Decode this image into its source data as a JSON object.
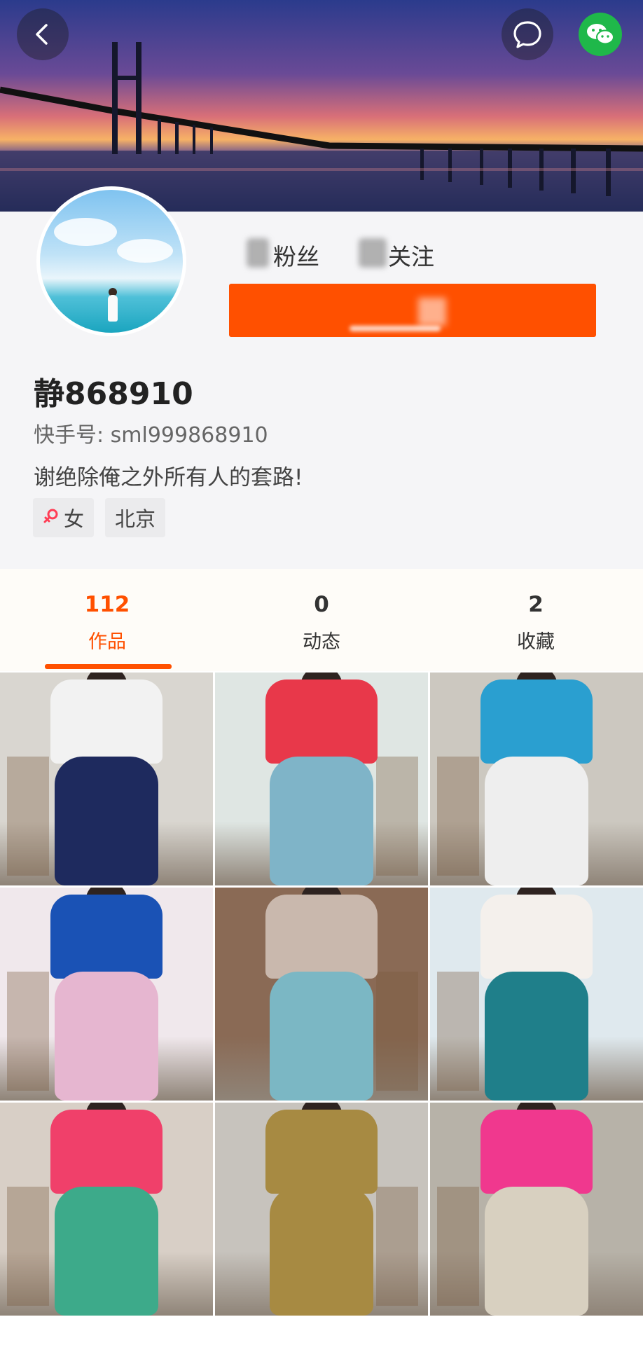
{
  "header": {
    "back_icon": "chevron-left-icon",
    "message_icon": "chat-bubble-icon",
    "share_icon": "wechat-icon",
    "wechat_color": "#1fb84a"
  },
  "profile": {
    "fans_label": "粉丝",
    "following_label": "关注",
    "follow_button_color": "#ff5000",
    "name": "静868910",
    "kuaishou_id": "快手号: sml999868910",
    "bio": "谢绝除俺之外所有人的套路!",
    "tags": {
      "gender": "女",
      "gender_icon": "female-icon",
      "city": "北京"
    }
  },
  "tabs": [
    {
      "count": "112",
      "label": "作品",
      "active": true
    },
    {
      "count": "0",
      "label": "动态",
      "active": false
    },
    {
      "count": "2",
      "label": "收藏",
      "active": false
    }
  ],
  "accent_color": "#ff5000",
  "videos": [
    {
      "id": "video-thumb-1",
      "shirt": "#f2f2f2",
      "pants": "#1e2a5e",
      "wall": "#d9d6d0"
    },
    {
      "id": "video-thumb-2",
      "shirt": "#e8384a",
      "pants": "#7fb4c8",
      "wall": "#dfe6e3"
    },
    {
      "id": "video-thumb-3",
      "shirt": "#2a9fd0",
      "pants": "#eeeeee",
      "wall": "#ccc8c0"
    },
    {
      "id": "video-thumb-4",
      "shirt": "#1a52b5",
      "pants": "#e6b6d0",
      "wall": "#f0e8ec"
    },
    {
      "id": "video-thumb-5",
      "shirt": "#c9b8ad",
      "pants": "#7bb7c4",
      "wall": "#8a6a55"
    },
    {
      "id": "video-thumb-6",
      "shirt": "#f4f0ec",
      "pants": "#1f7f8a",
      "wall": "#dfe9ee"
    },
    {
      "id": "video-thumb-7",
      "shirt": "#f0406a",
      "pants": "#3daa8a",
      "wall": "#d8cfc6"
    },
    {
      "id": "video-thumb-8",
      "shirt": "#a78a42",
      "pants": "#a78a42",
      "wall": "#c7c3bd"
    },
    {
      "id": "video-thumb-9",
      "shirt": "#f0388e",
      "pants": "#d8d0c0",
      "wall": "#b7b2a8"
    }
  ]
}
